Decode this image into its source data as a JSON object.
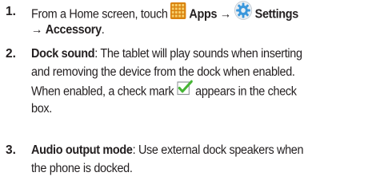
{
  "steps": [
    {
      "number": "1.",
      "prefix": "From a Home screen, touch",
      "apps_label": "Apps",
      "arrow": "→",
      "settings_label": "Settings",
      "accessory_label": "Accessory",
      "end": "."
    },
    {
      "number": "2.",
      "term": "Dock sound",
      "line1": ": The tablet will play sounds when inserting",
      "line2": "and removing the device from the dock when enabled.",
      "line3_a": "When enabled, a check mark",
      "line3_b": "appears in the check",
      "line4": "box."
    },
    {
      "number": "3.",
      "term": "Audio output mode",
      "line1": ": Use external dock speakers when",
      "line2": "the phone is docked."
    }
  ],
  "icons": {
    "apps": "apps-grid-icon",
    "settings": "gear-icon",
    "check": "checkbox-checked-icon"
  },
  "colors": {
    "text": "#231f20",
    "apps_icon": "#e39a1c",
    "settings_icon": "#2f8fd6",
    "check": "#46b535"
  }
}
